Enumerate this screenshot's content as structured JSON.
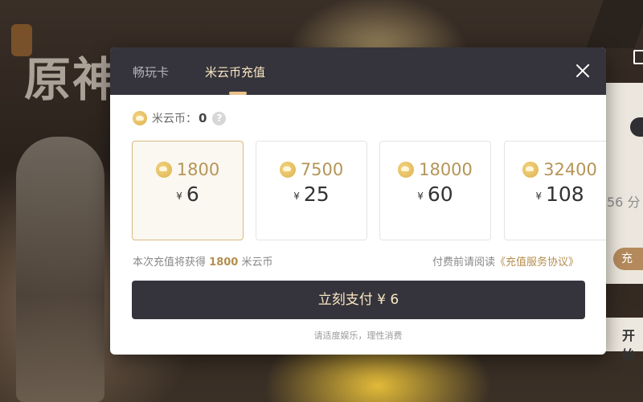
{
  "background": {
    "logo_text": "原神",
    "side_text": "56 分",
    "side_button": "充",
    "side_button_bottom": "开始"
  },
  "modal": {
    "tabs": [
      {
        "label": "畅玩卡",
        "active": false
      },
      {
        "label": "米云币充值",
        "active": true
      }
    ],
    "balance": {
      "label": "米云币：",
      "value": "0",
      "help_icon": "?"
    },
    "packages": [
      {
        "coins": "1800",
        "currency": "¥",
        "price": "6",
        "selected": true
      },
      {
        "coins": "7500",
        "currency": "¥",
        "price": "25",
        "selected": false
      },
      {
        "coins": "18000",
        "currency": "¥",
        "price": "60",
        "selected": false
      },
      {
        "coins": "32400",
        "currency": "¥",
        "price": "108",
        "selected": false
      }
    ],
    "gain": {
      "prefix": "本次充值将获得",
      "amount": "1800",
      "suffix": "米云币"
    },
    "agreement": {
      "prefix": "付费前请阅读",
      "link": "《充值服务协议》"
    },
    "pay_button": "立刻支付 ¥ 6",
    "footnote": "请适度娱乐，理性消费"
  },
  "colors": {
    "header": "#35343c",
    "accent": "#b58e4e",
    "tab_active": "#fbe7c4"
  }
}
